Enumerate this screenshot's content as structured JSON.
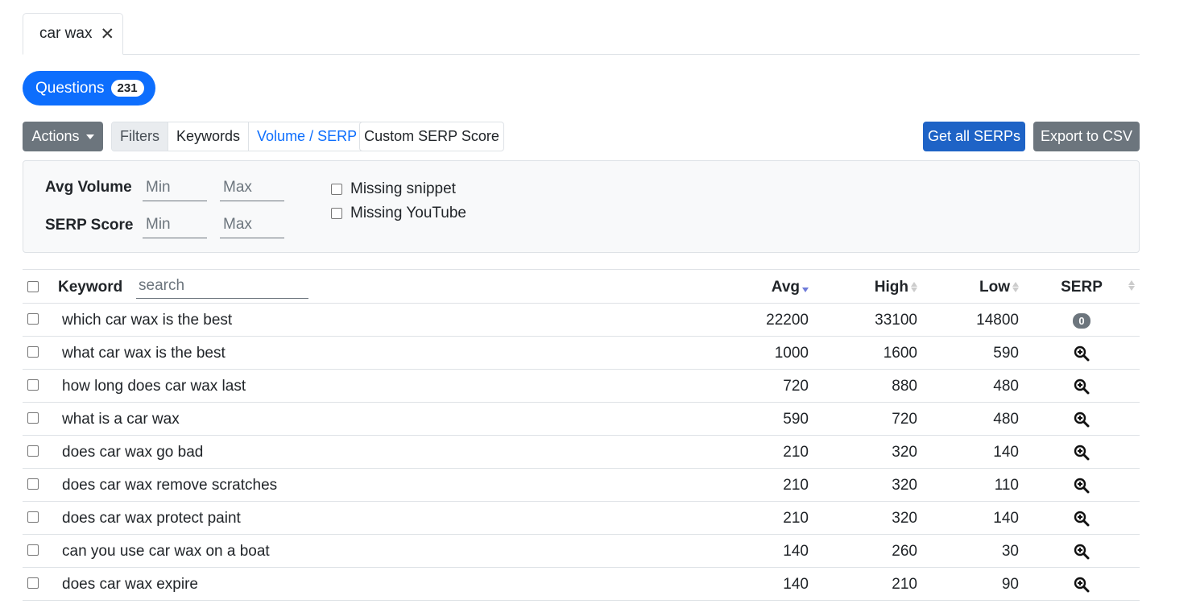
{
  "tab": {
    "label": "car wax",
    "close": "✕"
  },
  "questions": {
    "label": "Questions",
    "count": "231"
  },
  "toolbar": {
    "actions": "Actions",
    "filters": "Filters",
    "keywords": "Keywords",
    "volume_serp": "Volume / SERP",
    "custom_serp_score": "Custom SERP Score",
    "get_all_serps": "Get all SERPs",
    "export_csv": "Export to CSV"
  },
  "filters": {
    "avg_volume_label": "Avg Volume",
    "serp_score_label": "SERP Score",
    "min_placeholder": "Min",
    "max_placeholder": "Max",
    "missing_snippet": "Missing snippet",
    "missing_youtube": "Missing YouTube"
  },
  "table": {
    "headers": {
      "keyword": "Keyword",
      "search_placeholder": "search",
      "avg": "Avg",
      "high": "High",
      "low": "Low",
      "serp": "SERP"
    },
    "rows": [
      {
        "keyword": "which car wax is the best",
        "avg": "22200",
        "high": "33100",
        "low": "14800",
        "serp": "0"
      },
      {
        "keyword": "what car wax is the best",
        "avg": "1000",
        "high": "1600",
        "low": "590",
        "serp": ""
      },
      {
        "keyword": "how long does car wax last",
        "avg": "720",
        "high": "880",
        "low": "480",
        "serp": ""
      },
      {
        "keyword": "what is a car wax",
        "avg": "590",
        "high": "720",
        "low": "480",
        "serp": ""
      },
      {
        "keyword": "does car wax go bad",
        "avg": "210",
        "high": "320",
        "low": "140",
        "serp": ""
      },
      {
        "keyword": "does car wax remove scratches",
        "avg": "210",
        "high": "320",
        "low": "110",
        "serp": ""
      },
      {
        "keyword": "does car wax protect paint",
        "avg": "210",
        "high": "320",
        "low": "140",
        "serp": ""
      },
      {
        "keyword": "can you use car wax on a boat",
        "avg": "140",
        "high": "260",
        "low": "30",
        "serp": ""
      },
      {
        "keyword": "does car wax expire",
        "avg": "140",
        "high": "210",
        "low": "90",
        "serp": ""
      }
    ]
  }
}
